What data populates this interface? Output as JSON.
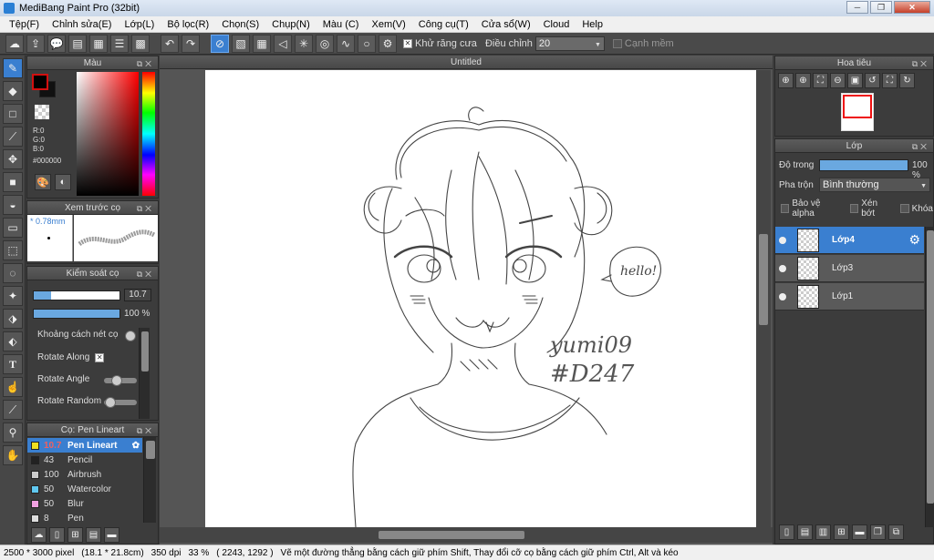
{
  "window": {
    "title": "MediBang Paint Pro (32bit)"
  },
  "menu": [
    "Tệp(F)",
    "Chỉnh sửa(E)",
    "Lớp(L)",
    "Bộ lọc(R)",
    "Chọn(S)",
    "Chụp(N)",
    "Màu (C)",
    "Xem(V)",
    "Công cụ(T)",
    "Cửa sổ(W)",
    "Cloud",
    "Help"
  ],
  "toolbar": {
    "antialias_label": "Khử răng cưa",
    "antialias_checked": "✕",
    "adjust_label": "Điều chỉnh",
    "adjust_value": "20",
    "smooth_label": "Cạnh mềm"
  },
  "color_panel": {
    "title": "Màu",
    "rgb_r": "R:0",
    "rgb_g": "G:0",
    "rgb_b": "B:0",
    "hex": "#000000",
    "fg_color": "#000000",
    "accent": "#d21010"
  },
  "brush_preview": {
    "title": "Xem trước cọ",
    "size": "* 0.78mm"
  },
  "brush_control": {
    "title": "Kiểm soát cọ",
    "size_value": "10.7",
    "size_fill": 0.2,
    "opacity_value": "100",
    "opacity_unit": "%",
    "opacity_fill": 1.0,
    "spacing_label": "Khoảng cách nét cọ",
    "rotate_along_label": "Rotate Along",
    "rotate_along_checked": "✕",
    "rotate_angle_label": "Rotate Angle",
    "rotate_random_label": "Rotate Random"
  },
  "brush_list": {
    "title": "Cọ: Pen Lineart",
    "items": [
      {
        "size": "10.7",
        "name": "Pen Lineart",
        "color": "#f0e020"
      },
      {
        "size": "43",
        "name": "Pencil",
        "color": "#222222"
      },
      {
        "size": "100",
        "name": "Airbrush",
        "color": "#cccccc"
      },
      {
        "size": "50",
        "name": "Watercolor",
        "color": "#60c8f0"
      },
      {
        "size": "50",
        "name": "Blur",
        "color": "#f0a0e0"
      },
      {
        "size": "8",
        "name": "Pen",
        "color": "#dddddd"
      }
    ]
  },
  "canvas": {
    "tab_title": "Untitled",
    "signature_1": "yumi09",
    "signature_2": "#D247",
    "bubble_text": "hello!"
  },
  "navigator": {
    "title": "Hoa tiêu"
  },
  "layers": {
    "title": "Lớp",
    "opacity_label": "Độ trong",
    "opacity_value": "100 %",
    "opacity_fill": 1.0,
    "blend_label": "Pha trộn",
    "blend_value": "Bình thường",
    "protect_alpha_label": "Bảo vệ alpha",
    "clip_label": "Xén bớt",
    "lock_label": "Khóa",
    "items": [
      {
        "name": "Lớp4"
      },
      {
        "name": "Lớp3"
      },
      {
        "name": "Lớp1"
      }
    ]
  },
  "status": {
    "size": "2500 * 3000 pixel",
    "physical": "(18.1 * 21.8cm)",
    "dpi": "350 dpi",
    "zoom": "33 %",
    "coords": "( 2243, 1292 )",
    "hint": "Vẽ một đường thẳng bằng cách giữ phím Shift, Thay đổi cỡ cọ bằng cách giữ phím Ctrl, Alt và kéo"
  }
}
